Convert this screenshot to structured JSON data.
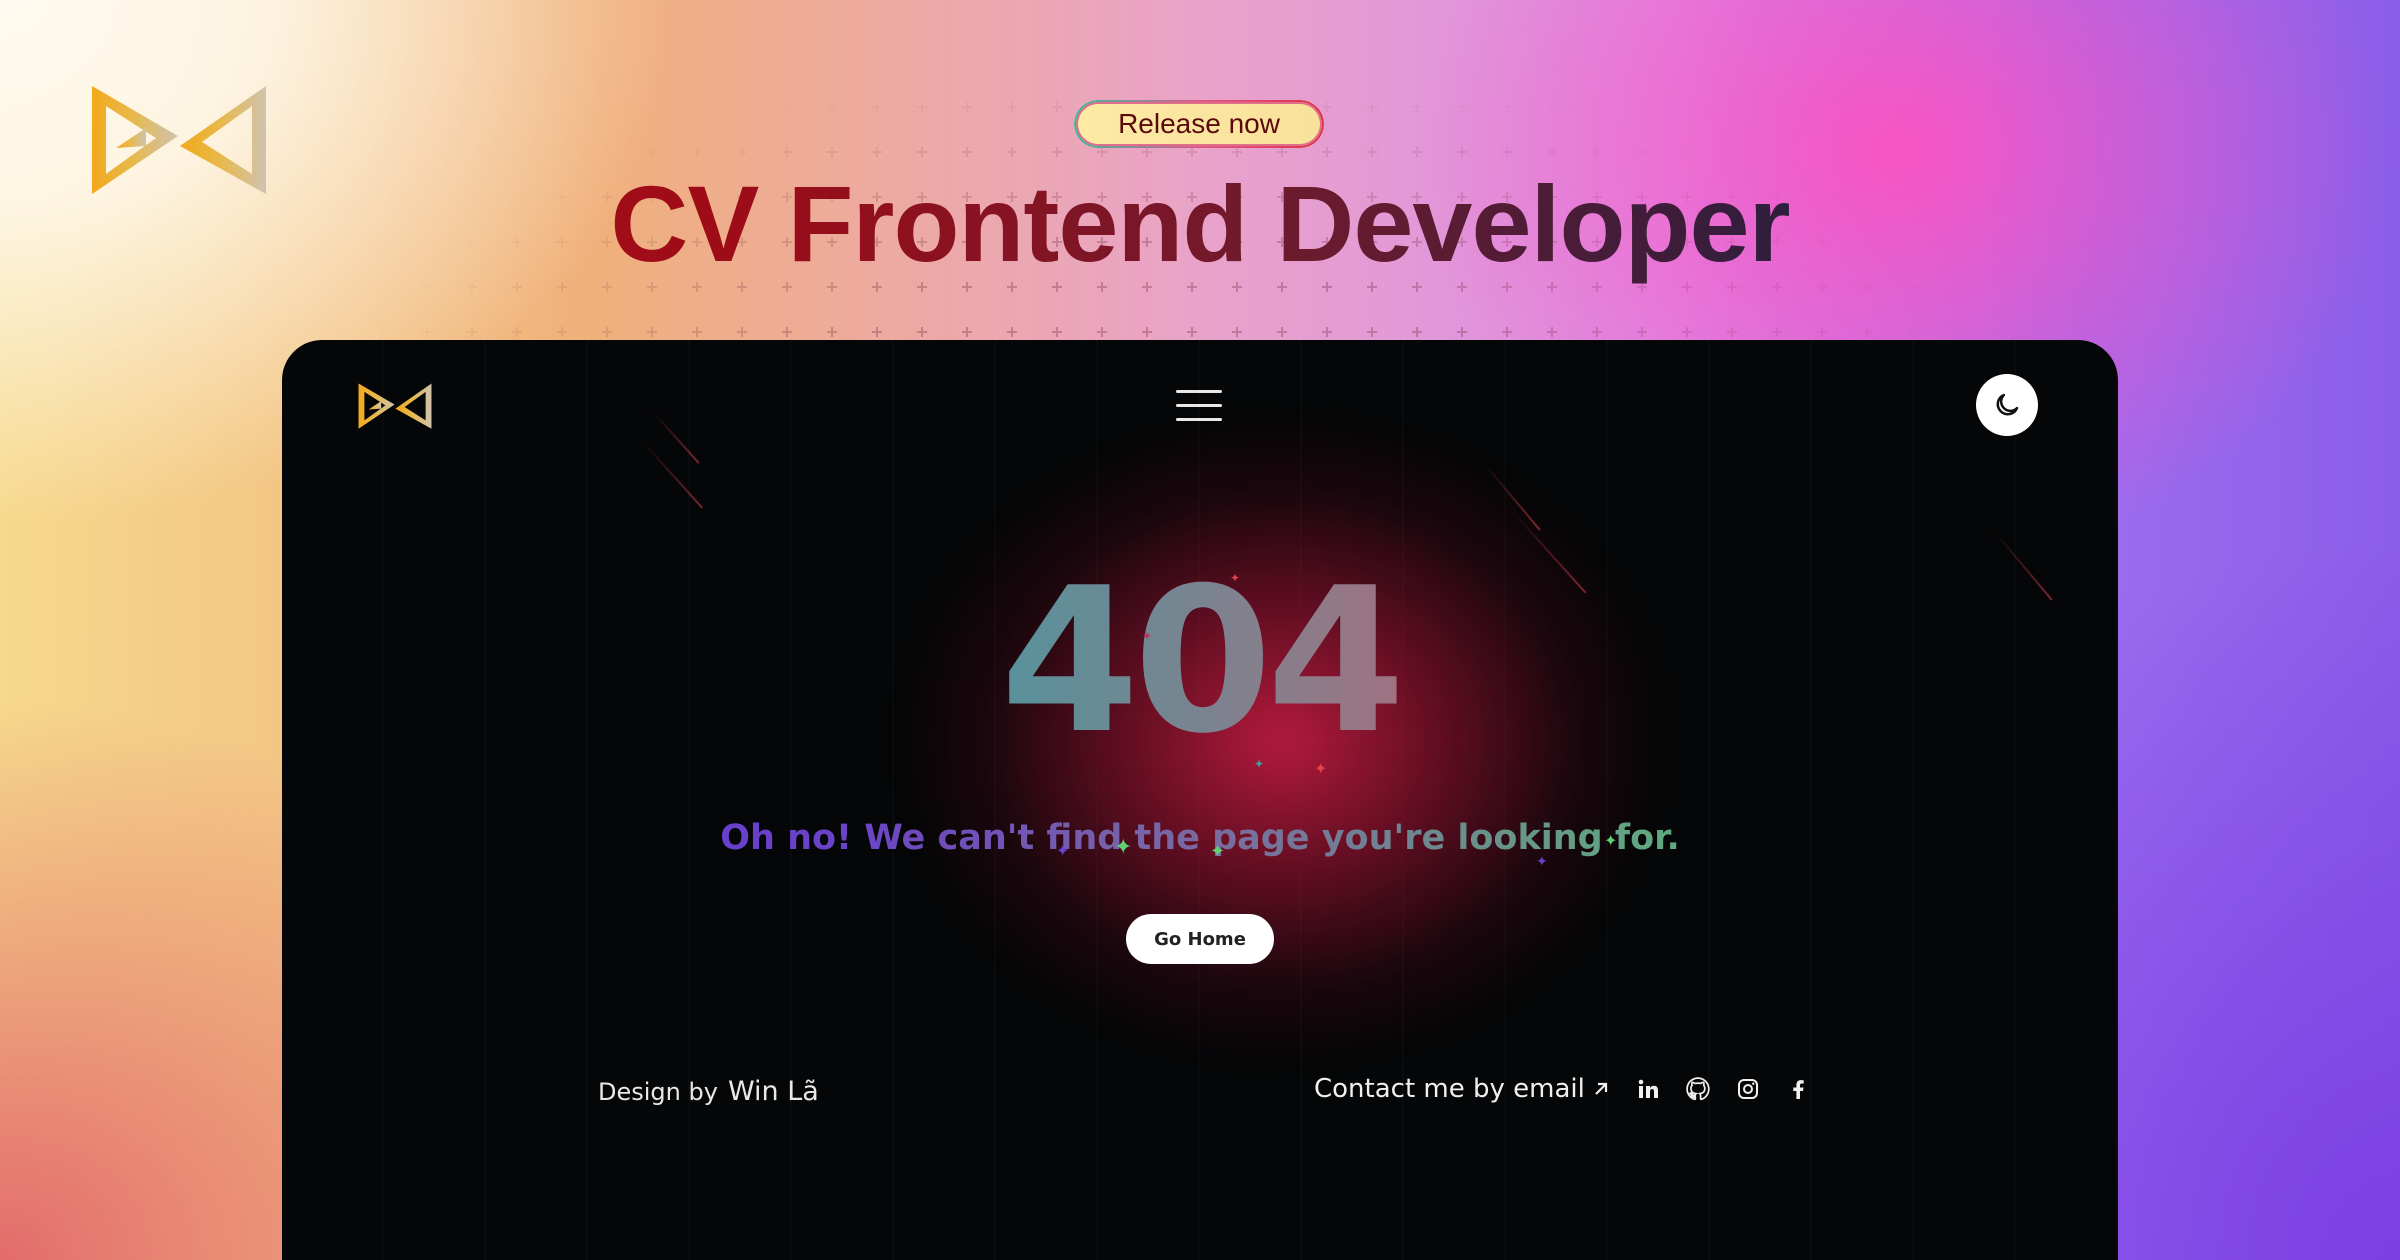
{
  "promo": {
    "badge": "Release now",
    "headline": "CV Frontend Developer"
  },
  "app": {
    "error_code": "404",
    "message": "Oh no! We can't find the page you're looking for.",
    "go_home_label": "Go Home",
    "footer": {
      "design_by_label": "Design by",
      "designer_name": "Win Lã",
      "contact_label": "Contact me by email",
      "social_icons": [
        "linkedin-icon",
        "github-icon",
        "instagram-icon",
        "facebook-icon"
      ]
    }
  },
  "colors": {
    "window_bg": "#050607",
    "glow": "#d21e46",
    "logo_gold": "#f0b020",
    "logo_silver": "#d8c8a8"
  }
}
